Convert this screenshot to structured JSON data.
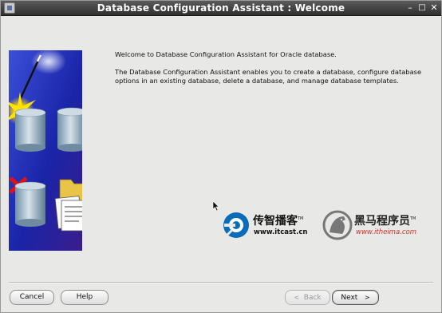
{
  "window": {
    "title": "Database Configuration Assistant : Welcome",
    "controls": {
      "minimize": "–",
      "maximize": "□",
      "close": "✕"
    }
  },
  "content": {
    "welcome": "Welcome to Database Configuration Assistant for Oracle database.",
    "description": "The Database Configuration Assistant enables you to create a database, configure database options in an existing database, delete a database, and manage database templates."
  },
  "watermark": {
    "itcast_name": "传智播客",
    "itcast_url": "www.itcast.cn",
    "itheima_name": "黑马程序员",
    "itheima_url": "www.itheima.com",
    "trademark": "TM"
  },
  "buttons": {
    "cancel": "Cancel",
    "help": "Help",
    "back": "Back",
    "back_arrow": "<",
    "next": "Next",
    "next_arrow": ">"
  },
  "colors": {
    "titlebar": "#3f3f3f",
    "background": "#e8e8e7",
    "hero_blue": "#1c2bb0",
    "itcast_blue": "#0b6db8",
    "itheima_red": "#d0302a"
  }
}
